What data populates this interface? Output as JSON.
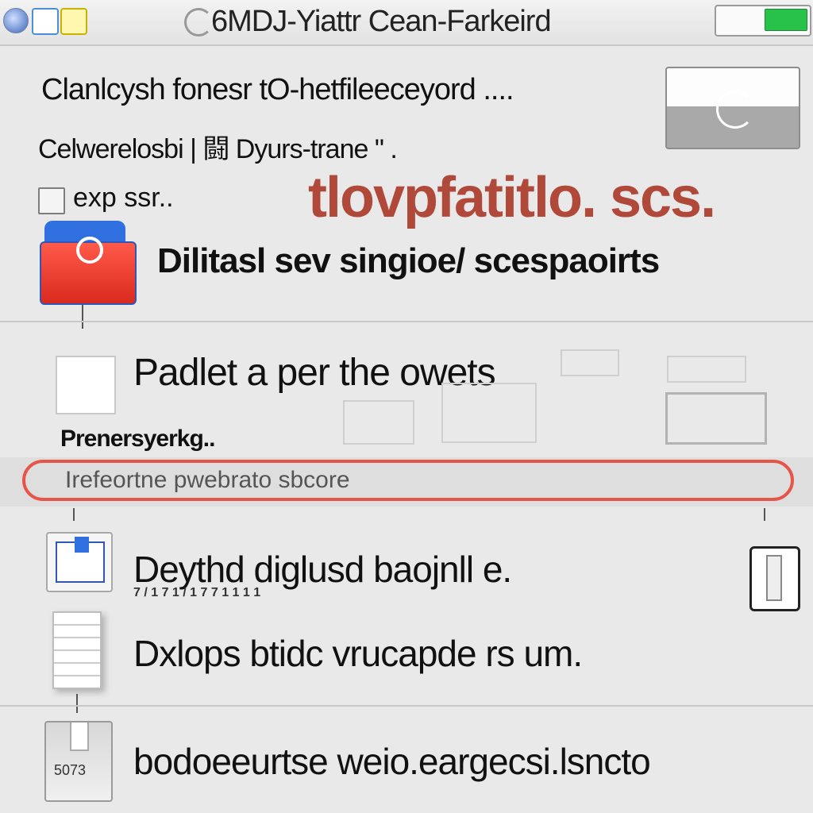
{
  "titlebar": {
    "title": "6MDJ-Yiattr Cean-Farkeird",
    "icons": [
      "globe-icon",
      "mail-icon",
      "notes-icon"
    ],
    "toggle_on": true,
    "toggle_color": "#28c24a"
  },
  "top": {
    "line1": "Clanlcysh fonesr tO-hetfileeceyord ....",
    "line2": "Celwerelosbi | 闘 Dyurs-trane \" .",
    "checkbox_label": "exp ssr..",
    "red_heading": "tlovpfatitlo. scs.",
    "red_heading_color": "#b0493a",
    "app_title": "Dilitasl sev singioe/ scespaoirts"
  },
  "middle": {
    "title": "Padlet a per the owets",
    "sub_heading": "Prenersyerkg..",
    "search_placeholder": "Irefeortne pwebrato sbcore",
    "search_border_color": "#e6554a"
  },
  "rows": [
    {
      "title": "Deythd diglusd baojnll e.",
      "subtitle": "7 / 1  7  1 / 1 7 7 1 1 1 1"
    },
    {
      "title": "Dxlops btidc vrucapde rs um."
    },
    {
      "title": "bodoeeurtse weio.eargecsi.lsncto",
      "icon_text": "5073"
    }
  ]
}
